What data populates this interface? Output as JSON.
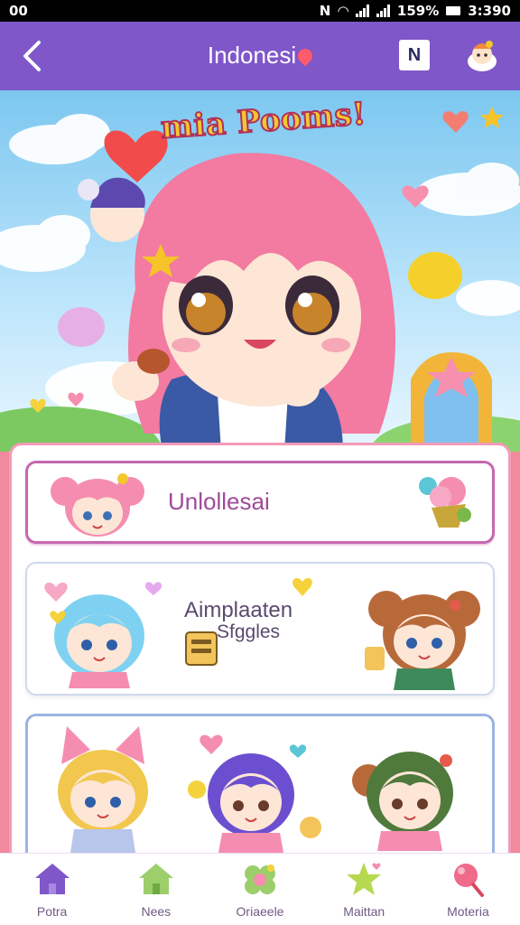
{
  "status_bar": {
    "left_text": "00",
    "battery": "159%",
    "time": "3:390"
  },
  "app_bar": {
    "title": "Indonesi",
    "n_button_label": "N"
  },
  "banner": {
    "title": "mia Pooms!"
  },
  "cards": [
    {
      "label": "Unlollesai"
    },
    {
      "label": "Aimplaaten",
      "sublabel": "Sfggles"
    },
    {
      "label": ""
    }
  ],
  "bottom_nav": [
    {
      "label": "Potra",
      "icon": "house-icon",
      "color": "#7f57c9"
    },
    {
      "label": "Nees",
      "icon": "house-icon",
      "color": "#9ccf6c"
    },
    {
      "label": "Oriaeele",
      "icon": "flower-icon",
      "color": "#9ccf6c"
    },
    {
      "label": "Maittan",
      "icon": "star-icon",
      "color": "#b6d94f"
    },
    {
      "label": "Moteria",
      "icon": "candy-icon",
      "color": "#f06a8a"
    }
  ],
  "colors": {
    "app_bar": "#7f57c9",
    "accent_pink": "#f29bb8",
    "card_border_purple": "#c568b0",
    "card_border_blue": "#9bb4e2"
  }
}
